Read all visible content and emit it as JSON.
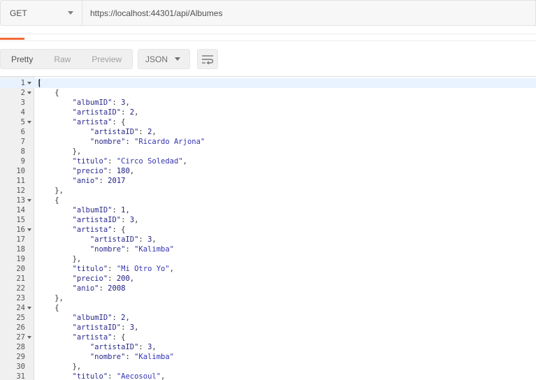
{
  "request": {
    "method": "GET",
    "url": "https://localhost:44301/api/Albumes"
  },
  "colors": {
    "accent": "#f26b3a"
  },
  "toolbar": {
    "views": [
      "Pretty",
      "Raw",
      "Preview"
    ],
    "active_view": "Pretty",
    "format": "JSON",
    "wrap_icon": "wrap-lines-icon"
  },
  "editor": {
    "fold_lines": [
      1,
      2,
      5,
      13,
      16,
      24,
      27
    ],
    "active_line": 1,
    "lines": [
      "[",
      "    {",
      "        \"albumID\": 3,",
      "        \"artistaID\": 2,",
      "        \"artista\": {",
      "            \"artistaID\": 2,",
      "            \"nombre\": \"Ricardo Arjona\"",
      "        },",
      "        \"titulo\": \"Circo Soledad\",",
      "        \"precio\": 180,",
      "        \"anio\": 2017",
      "    },",
      "    {",
      "        \"albumID\": 1,",
      "        \"artistaID\": 3,",
      "        \"artista\": {",
      "            \"artistaID\": 3,",
      "            \"nombre\": \"Kalimba\"",
      "        },",
      "        \"titulo\": \"Mi Otro Yo\",",
      "        \"precio\": 200,",
      "        \"anio\": 2008",
      "    },",
      "    {",
      "        \"albumID\": 2,",
      "        \"artistaID\": 3,",
      "        \"artista\": {",
      "            \"artistaID\": 3,",
      "            \"nombre\": \"Kalimba\"",
      "        },",
      "        \"titulo\": \"Aecosoul\","
    ]
  }
}
